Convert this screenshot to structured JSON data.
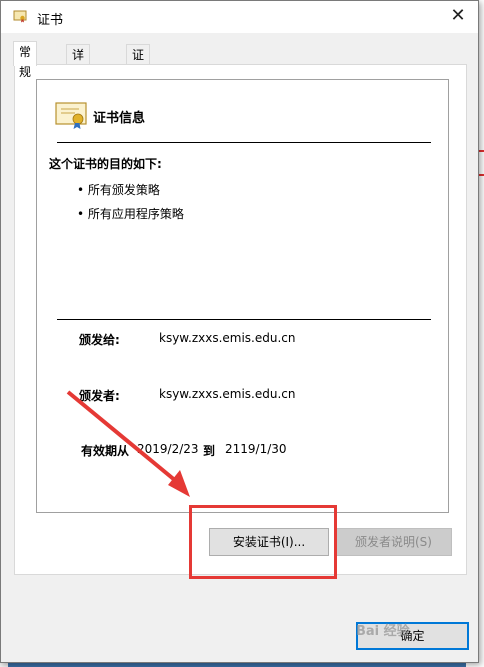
{
  "window": {
    "title": "证书",
    "close_glyph": "✕"
  },
  "tabs": [
    {
      "label": "常规",
      "active": true
    },
    {
      "label": "详细信息",
      "active": false
    },
    {
      "label": "证书路径",
      "active": false
    }
  ],
  "cert": {
    "header": "证书信息",
    "purpose_title": "这个证书的目的如下:",
    "purposes": [
      "所有颁发策略",
      "所有应用程序策略"
    ],
    "issued_to_label": "颁发给:",
    "issued_to_value": "ksyw.zxxs.emis.edu.cn",
    "issued_by_label": "颁发者:",
    "issued_by_value": "ksyw.zxxs.emis.edu.cn",
    "valid_label": "有效期从",
    "valid_from": "2019/2/23",
    "valid_to_word": "到",
    "valid_to": "2119/1/30"
  },
  "buttons": {
    "install": "安装证书(I)...",
    "issuer_statement": "颁发者说明(S)",
    "ok": "确定"
  },
  "annotation": {
    "color": "#e53935"
  },
  "watermark": "Bai 经验"
}
